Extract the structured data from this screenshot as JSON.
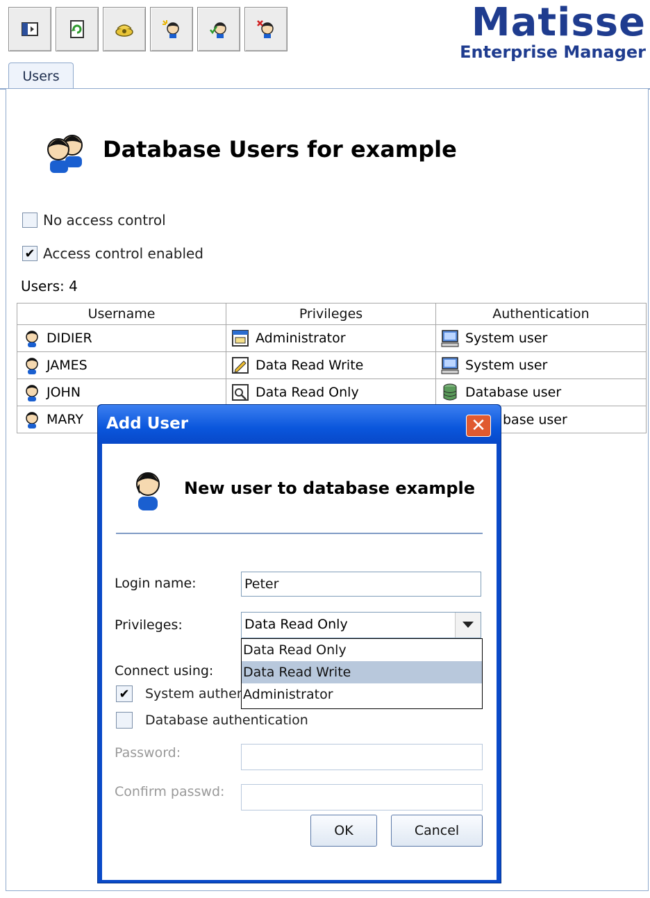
{
  "toolbar": {
    "buttons": [
      {
        "icon": "panel-toggle-icon"
      },
      {
        "icon": "refresh-icon"
      },
      {
        "icon": "connect-icon"
      },
      {
        "icon": "new-user-icon"
      },
      {
        "icon": "edit-user-icon"
      },
      {
        "icon": "delete-user-icon"
      }
    ]
  },
  "logo": {
    "title": "Matisse",
    "subtitle": "Enterprise Manager"
  },
  "tabs": [
    {
      "label": "Users"
    }
  ],
  "page": {
    "title": "Database Users for example",
    "no_access_control": {
      "label": "No access control",
      "checked": false
    },
    "access_control_enabled": {
      "label": "Access control enabled",
      "checked": true
    },
    "users_count": "Users: 4"
  },
  "table": {
    "columns": [
      "Username",
      "Privileges",
      "Authentication"
    ],
    "rows": [
      {
        "username": "DIDIER",
        "privileges": "Administrator",
        "authentication": "System user"
      },
      {
        "username": "JAMES",
        "privileges": "Data Read Write",
        "authentication": "System user"
      },
      {
        "username": "JOHN",
        "privileges": "Data Read Only",
        "authentication": "Database user"
      },
      {
        "username": "MARY",
        "privileges": "",
        "authentication": "base user"
      }
    ]
  },
  "dialog": {
    "title": "Add User",
    "close_glyph": "✕",
    "heading": "New user to database example",
    "login_label": "Login name:",
    "login_value": "Peter",
    "privileges_label": "Privileges:",
    "privileges_value": "Data Read Only",
    "privileges_options": [
      "Data Read Only",
      "Data Read Write",
      "Administrator"
    ],
    "highlighted_option": "Data Read Write",
    "connect_label": "Connect using:",
    "system_auth": {
      "label": "System authen",
      "checked": true
    },
    "database_auth": {
      "label": "Database authentication",
      "checked": false
    },
    "password_label": "Password:",
    "confirm_label": "Confirm passwd:",
    "ok_label": "OK",
    "cancel_label": "Cancel"
  },
  "colors": {
    "accent": "#1f3c8f",
    "titlebar": "#0a56dc",
    "highlight": "#b8c8dc"
  }
}
